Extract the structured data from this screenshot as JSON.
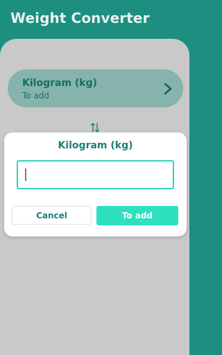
{
  "app": {
    "title": "Weight Converter"
  },
  "unit_card": {
    "name": "Kilogram (kg)",
    "subtitle": "To add",
    "icon": "chevron-right-icon"
  },
  "swap": {
    "icon": "swap-vertical-icon"
  },
  "dialog": {
    "title": "Kilogram (kg)",
    "input_value": "",
    "cancel_label": "Cancel",
    "confirm_label": "To add"
  },
  "colors": {
    "primary": "#1d8f80",
    "accent": "#2ee0bf",
    "overlay": "#c9c9c9"
  }
}
